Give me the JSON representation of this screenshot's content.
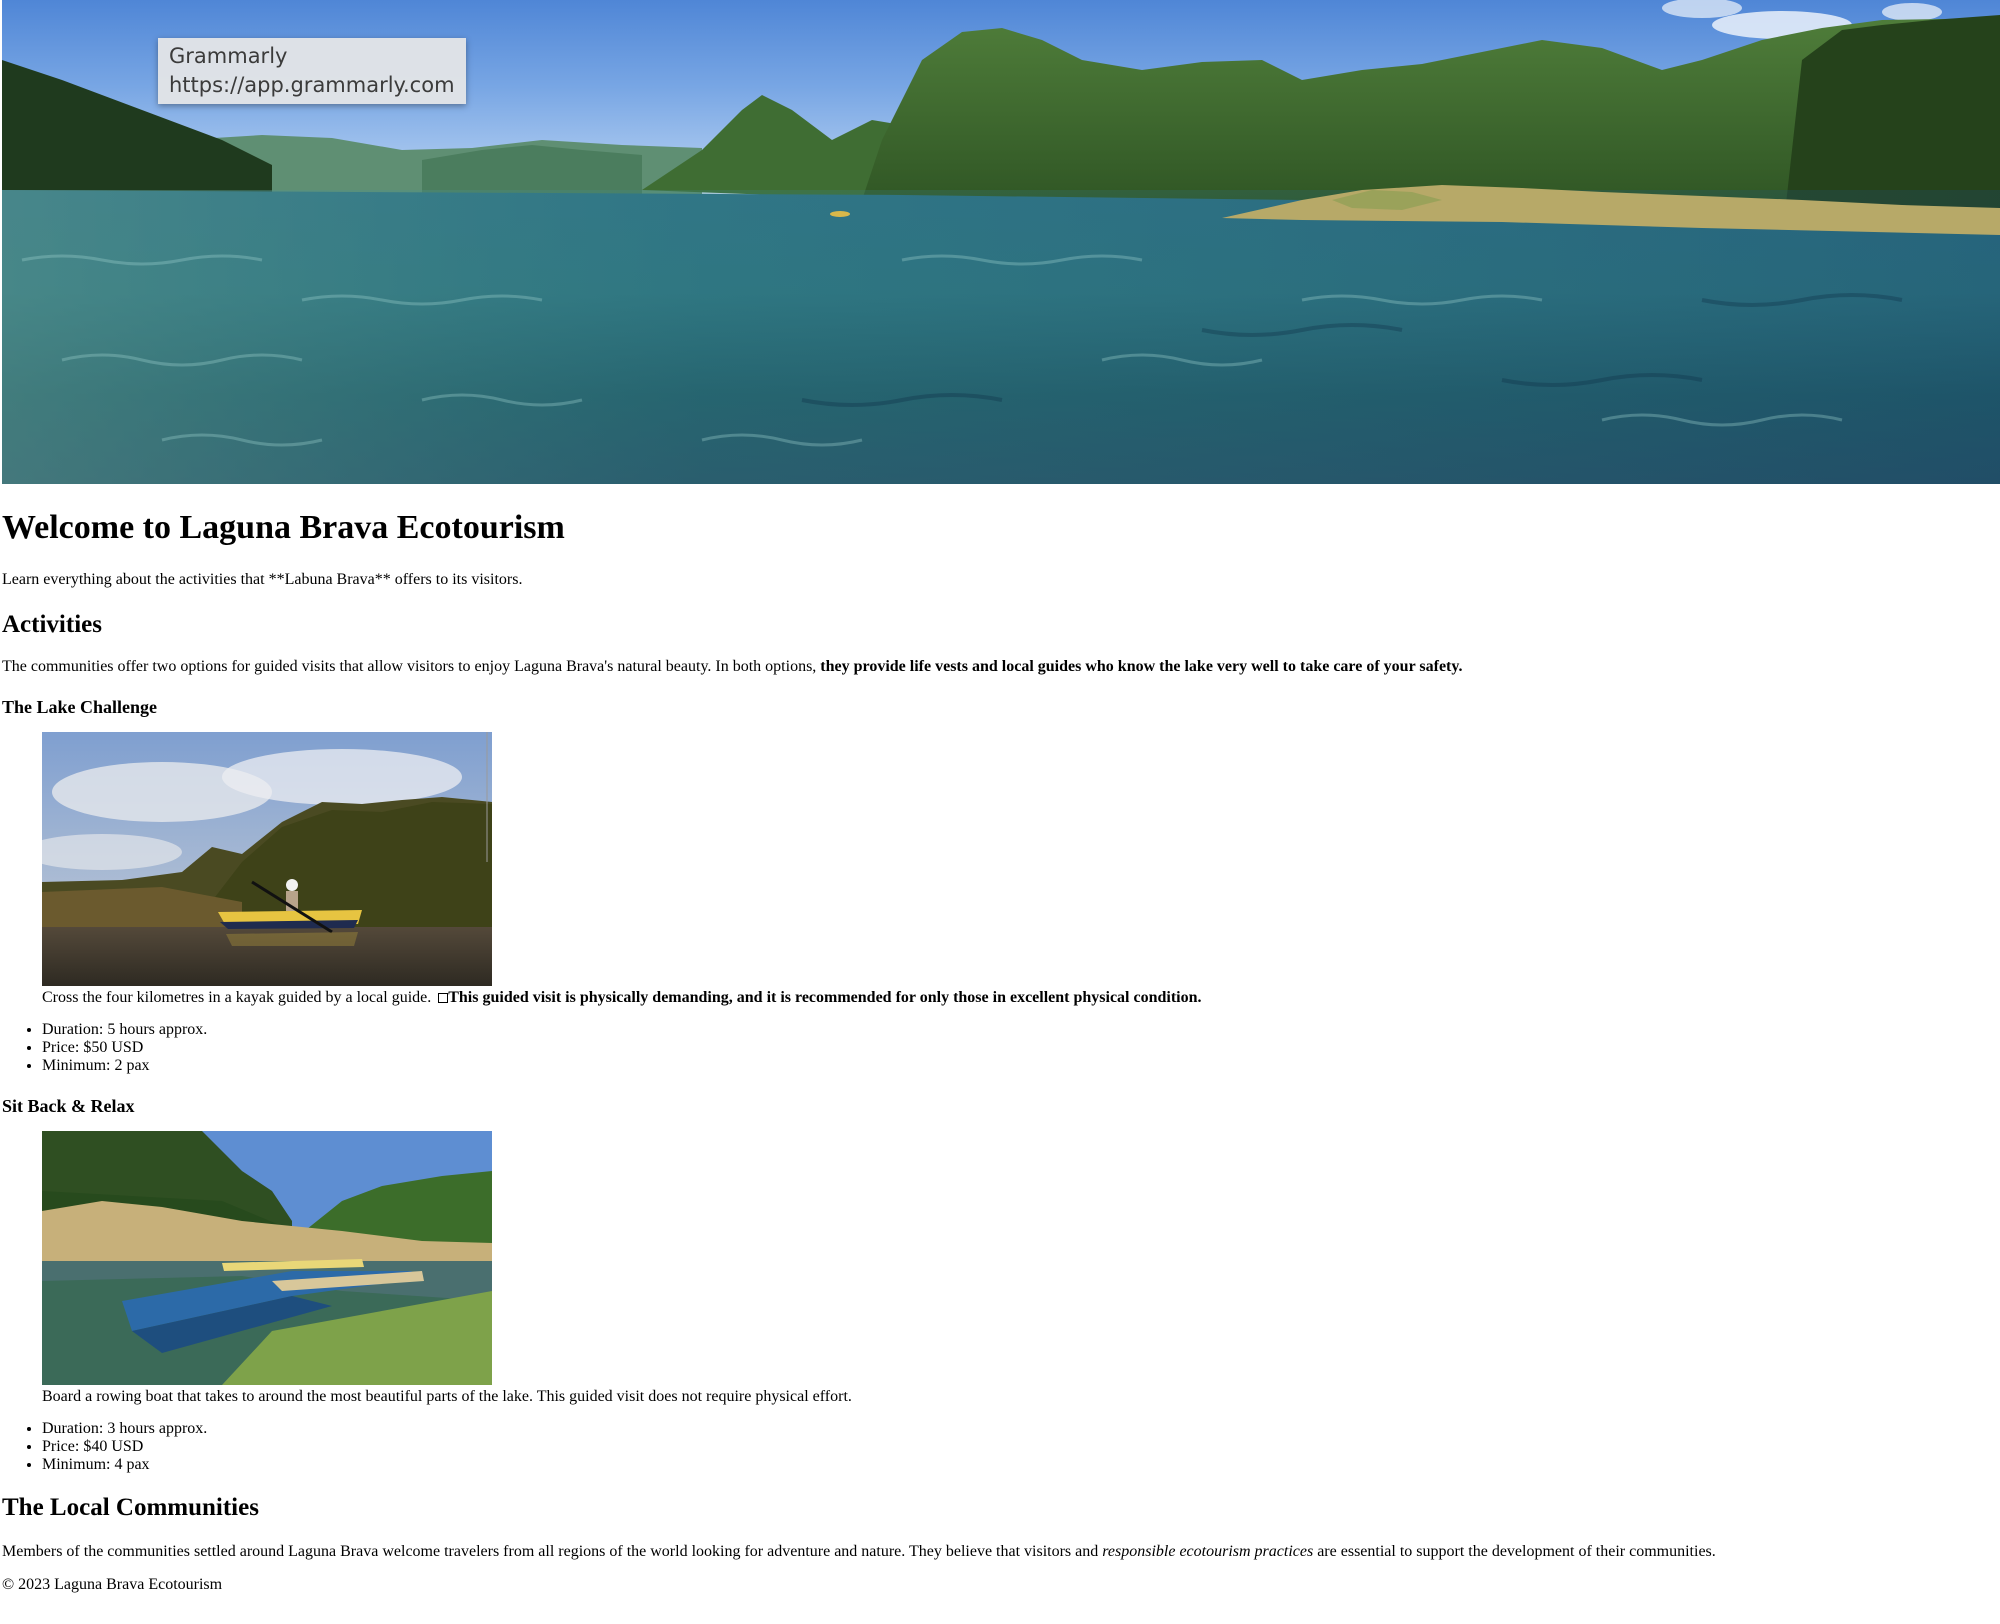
{
  "hero": {
    "tooltip": {
      "app_name": "Grammarly",
      "url": "https://app.grammarly.com"
    }
  },
  "page": {
    "title": "Welcome to Laguna Brava Ecotourism",
    "intro": "Learn everything about the activities that **Labuna Brava** offers to its visitors."
  },
  "activities": {
    "heading": "Activities",
    "text_plain": "The communities offer two options for guided visits that allow visitors to enjoy Laguna Brava's natural beauty. In both options, ",
    "text_bold": "they provide life vests and local guides who know the lake very well to take care of your safety.",
    "lake_challenge": {
      "heading": "The Lake Challenge",
      "caption_plain": "Cross the four kilometres in a kayak guided by a local guide. ",
      "caption_bold": "This guided visit is physically demanding, and it is recommended for only those in excellent physical condition.",
      "details": [
        "Duration: 5 hours approx.",
        "Price: $50 USD",
        "Minimum: 2 pax"
      ]
    },
    "sit_back": {
      "heading": "Sit Back & Relax",
      "caption": "Board a rowing boat that takes to around the most beautiful parts of the lake. This guided visit does not require physical effort.",
      "details": [
        "Duration: 3 hours approx.",
        "Price: $40 USD",
        "Minimum: 4 pax"
      ]
    }
  },
  "communities": {
    "heading": "The Local Communities",
    "text_before": "Members of the communities settled around Laguna Brava welcome travelers from all regions of the world looking for adventure and nature. They believe that visitors and ",
    "text_italic": "responsible ecotourism practices",
    "text_after": " are essential to support the development of their communities."
  },
  "footer": {
    "text": "© 2023 Laguna Brava Ecotourism"
  },
  "colors": {
    "sky": "#78a6e4",
    "water": "#1f5f7a",
    "forest": "#3c6a2c"
  }
}
